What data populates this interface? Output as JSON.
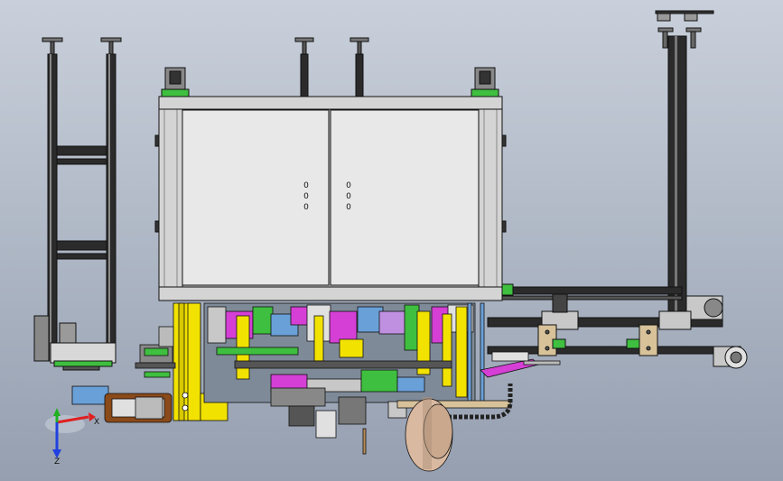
{
  "view": {
    "background_top": "#c9d0db",
    "background_bottom": "#959fb0"
  },
  "triad": {
    "x_label": "X",
    "z_label": "Z",
    "x_color": "#e02020",
    "y_color": "#20b020",
    "z_color": "#2040e0"
  },
  "colors": {
    "frame": "#1a1a1a",
    "panel": "#e8e8e8",
    "panel_frame": "#c8c8c8",
    "yellow": "#f2e200",
    "green": "#3fbf3f",
    "magenta": "#d53fd5",
    "brown": "#8a4a1a",
    "tan": "#d8c29a",
    "steel_blue": "#6aa0d8",
    "wheel": "#d9b9a0"
  },
  "cabinet": {
    "door_left_marks": [
      "0",
      "0",
      "0"
    ],
    "door_right_marks": [
      "0",
      "0",
      "0"
    ]
  },
  "icons": [
    "coordinate-triad-icon"
  ]
}
